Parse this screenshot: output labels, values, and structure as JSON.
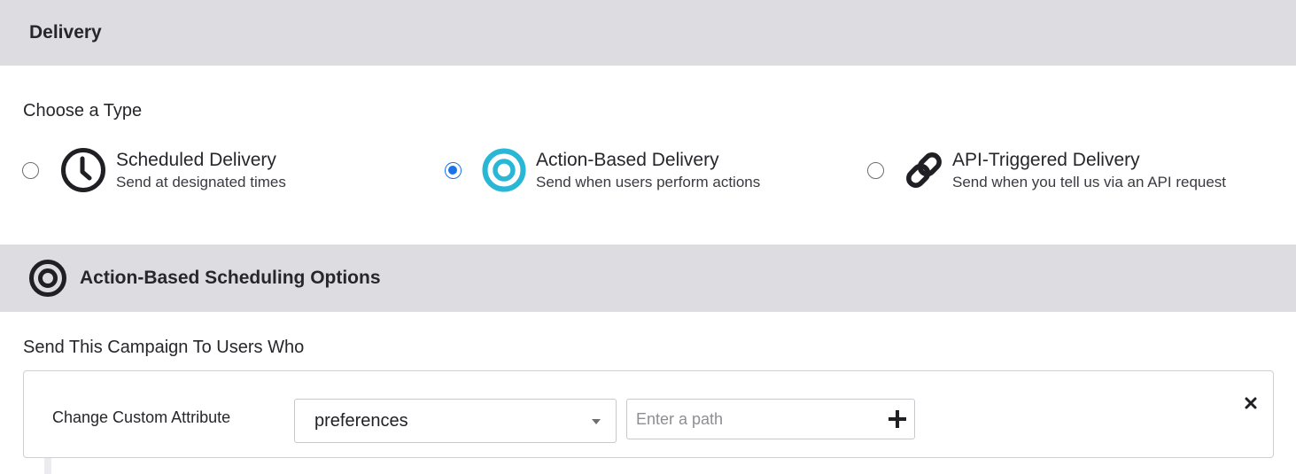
{
  "delivery": {
    "header_title": "Delivery",
    "choose_label": "Choose a Type",
    "types": [
      {
        "title": "Scheduled Delivery",
        "description": "Send at designated times",
        "icon": "clock-icon",
        "selected": false
      },
      {
        "title": "Action-Based Delivery",
        "description": "Send when users perform actions",
        "icon": "target-icon",
        "selected": true
      },
      {
        "title": "API-Triggered Delivery",
        "description": "Send when you tell us via an API request",
        "icon": "link-icon",
        "selected": false
      }
    ]
  },
  "scheduling": {
    "header_title": "Action-Based Scheduling Options",
    "icon": "target-icon",
    "send_label": "Send This Campaign To Users Who"
  },
  "trigger": {
    "action_label": "Change Custom Attribute",
    "attribute_select_value": "preferences",
    "path_placeholder": "Enter a path",
    "path_value": "",
    "add_icon": "plus-icon",
    "remove_icon": "close-icon"
  },
  "colors": {
    "header_bg": "#dcdce1",
    "accent_cyan": "#2ab7d6",
    "radio_selected": "#1a73e8",
    "text": "#26262b"
  }
}
